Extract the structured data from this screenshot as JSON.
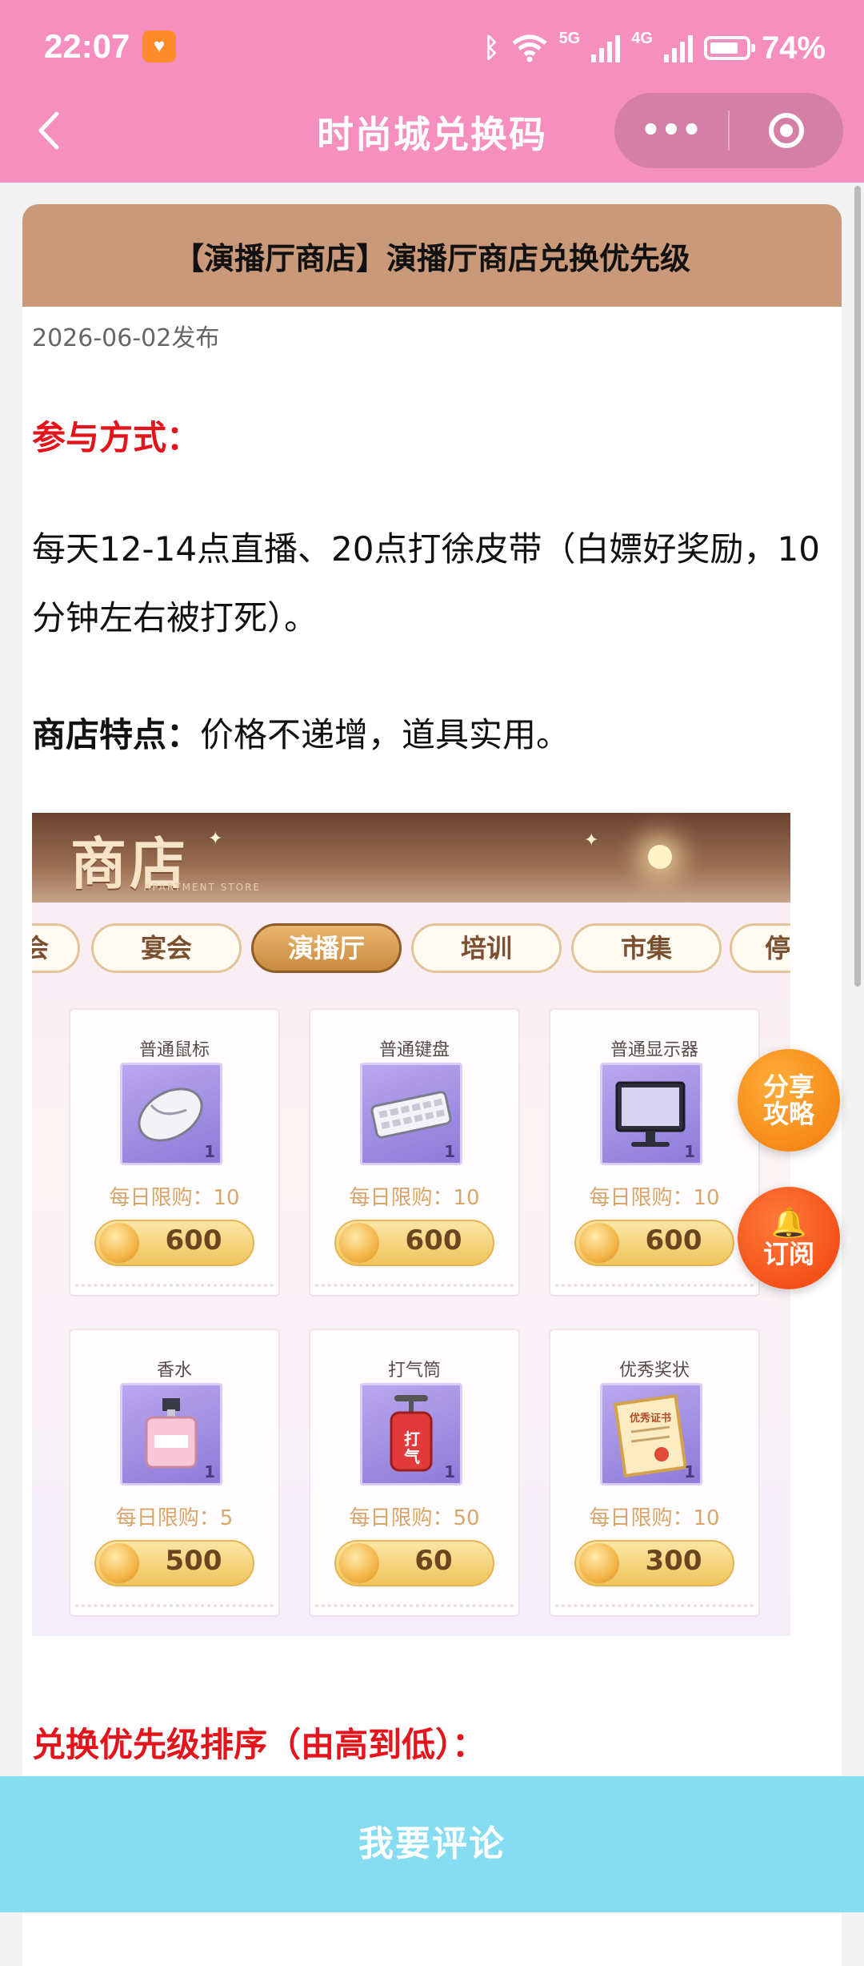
{
  "status_bar": {
    "time": "22:07",
    "network_1": "5G",
    "network_2": "4G",
    "battery": "74%"
  },
  "nav": {
    "title": "时尚城兑换码",
    "more_icon": "•••"
  },
  "article": {
    "header": "【演播厅商店】演播厅商店兑换优先级",
    "publish_date": "2026-06-02发布",
    "section1_title": "参与方式：",
    "section1_text": "每天12-14点直播、20点打徐皮带（白嫖好奖励，10分钟左右被打死）。",
    "feature_label": "商店特点：",
    "feature_text": "价格不递增，道具实用。",
    "section2_title": "兑换优先级排序（由高到低）："
  },
  "shop_image": {
    "title": "商店",
    "subtitle": "APARTMENT STORE",
    "tabs": [
      "会",
      "宴会",
      "演播厅",
      "培训",
      "市集",
      "停"
    ],
    "active_tab": "演播厅",
    "items": [
      {
        "name": "普通鼠标",
        "icon": "mouse-icon",
        "qty": "1",
        "limit": "每日限购：10",
        "price": "600"
      },
      {
        "name": "普通键盘",
        "icon": "keyboard-icon",
        "qty": "1",
        "limit": "每日限购：10",
        "price": "600"
      },
      {
        "name": "普通显示器",
        "icon": "monitor-icon",
        "qty": "1",
        "limit": "每日限购：10",
        "price": "600"
      },
      {
        "name": "香水",
        "icon": "perfume-icon",
        "qty": "1",
        "limit": "每日限购：5",
        "price": "500"
      },
      {
        "name": "打气筒",
        "icon": "air-pump-icon",
        "qty": "1",
        "limit": "每日限购：50",
        "price": "60",
        "icon_text": "打气"
      },
      {
        "name": "优秀奖状",
        "icon": "certificate-icon",
        "qty": "1",
        "limit": "每日限购：10",
        "price": "300",
        "icon_text": "优秀证书"
      }
    ]
  },
  "floating": {
    "share_line1": "分享",
    "share_line2": "攻略",
    "subscribe": "订阅"
  },
  "bottom_bar": {
    "comment_label": "我要评论"
  },
  "colors": {
    "header_bg": "#f48fbe",
    "card_head_bg": "#c9997a",
    "accent_red": "#e3141c",
    "bottom_bar_bg": "#86dcf0"
  }
}
